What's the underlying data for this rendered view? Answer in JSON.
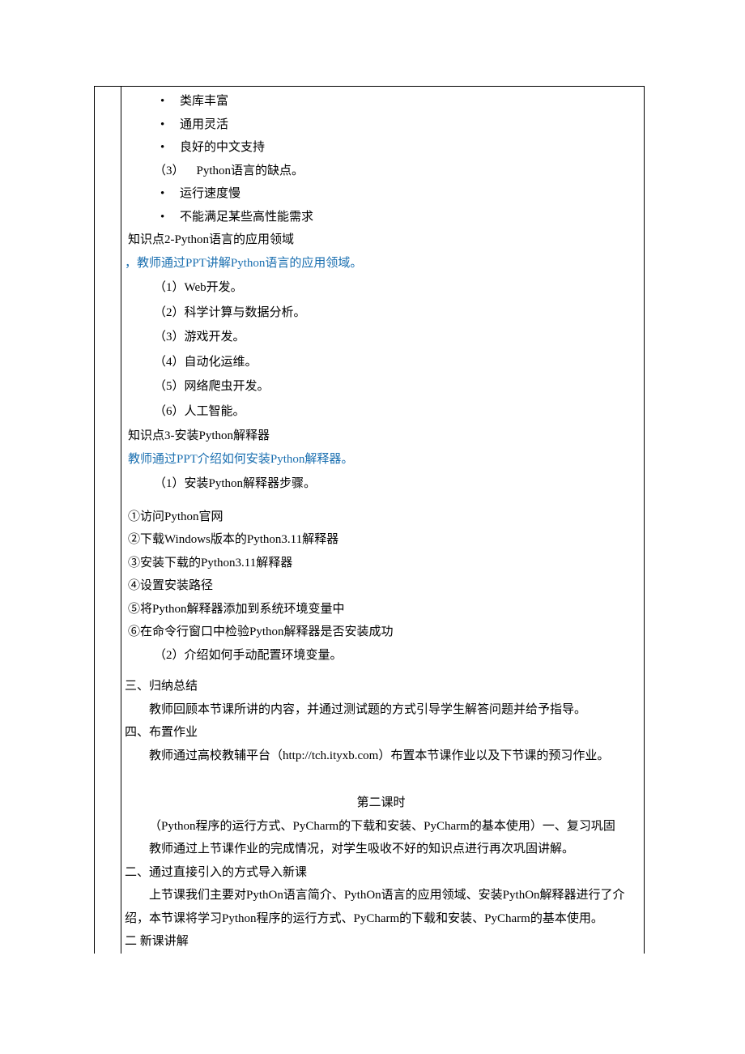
{
  "bullets_top": [
    "类库丰富",
    "通用灵活",
    "良好的中文支持"
  ],
  "cons_heading_num": "（3）",
  "cons_heading_text": "Python语言的缺点。",
  "cons_bullets": [
    "运行速度慢",
    "不能满足某些高性能需求"
  ],
  "knowledge2_title": "知识点2-Python语言的应用领域",
  "knowledge2_blue": "，教师通过PPT讲解Python语言的应用领域。",
  "app_fields": [
    "（1）Web开发。",
    "（2）科学计算与数据分析。",
    "（3）游戏开发。",
    "（4）自动化运维。",
    "（5）网络爬虫开发。",
    "（6）人工智能。"
  ],
  "knowledge3_title": "知识点3-安装Python解释器",
  "knowledge3_blue": "教师通过PPT介绍如何安装Python解释器。",
  "install_step_intro": "（1）安装Python解释器步骤。",
  "install_steps": [
    "①访问Python官网",
    "②下载Windows版本的Python3.11解释器",
    "③安装下载的Python3.11解释器",
    "④设置安装路径",
    "⑤将Python解释器添加到系统环境变量中",
    "⑥在命令行窗口中检验Python解释器是否安装成功"
  ],
  "install_step2": "（2）介绍如何手动配置环境变量。",
  "section3_title": "三、归纳总结",
  "section3_body": "教师回顾本节课所讲的内容，并通过测试题的方式引导学生解答问题并给予指导。",
  "section4_title": "四、布置作业",
  "section4_body": "教师通过高校教辅平台（http://tch.ityxb.com）布置本节课作业以及下节课的预习作业。",
  "lesson2_title": "第二课时",
  "lesson2_subtitle": "（Python程序的运行方式、PyCharm的下载和安装、PyCharm的基本使用）一、复习巩固",
  "lesson2_body1": "教师通过上节课作业的完成情况，对学生吸收不好的知识点进行再次巩固讲解。",
  "lesson2_sec2_title": "二、通过直接引入的方式导入新课",
  "lesson2_sec2_body": "上节课我们主要对PythOn语言简介、PythOn语言的应用领域、安装PythOn解释器进行了介绍，本节课将学习Python程序的运行方式、PyCharm的下载和安装、PyCharm的基本使用。",
  "lesson2_truncated": "二    新课讲解"
}
